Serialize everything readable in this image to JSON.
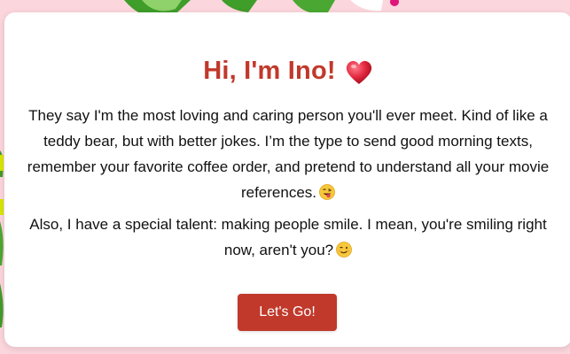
{
  "card": {
    "title": "Hi, I'm Ino!",
    "title_icon": "heart-icon",
    "paragraph1": "They say I'm the most loving and caring person you'll ever meet. Kind of like a teddy bear, but with better jokes. I’m the type to send good morning texts, remember your favorite coffee order, and pretend to understand all your movie references.",
    "paragraph1_icon": "tongue-wink-emoji-icon",
    "paragraph2": "Also, I have a special talent: making people smile. I mean, you're smiling right now, aren't you?",
    "paragraph2_icon": "winking-face-emoji-icon",
    "button_label": "Let's Go!"
  },
  "colors": {
    "accent": "#c0392b",
    "background": "#fbd6dc",
    "card": "#ffffff",
    "text": "#111111"
  }
}
